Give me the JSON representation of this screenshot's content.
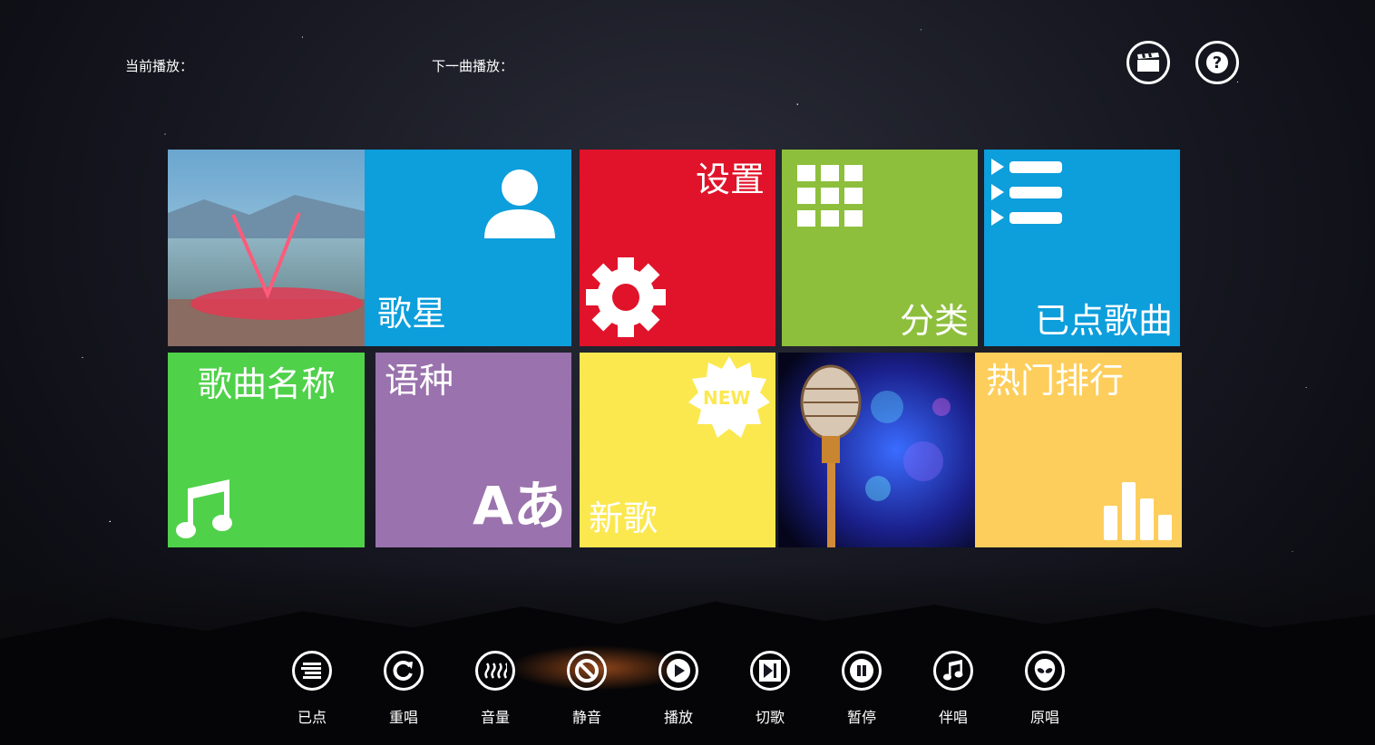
{
  "header": {
    "now_playing_label": "当前播放：",
    "next_song_label": "下一曲播放："
  },
  "tiles": {
    "singer": "歌星",
    "settings": "设置",
    "category": "分类",
    "requested": "已点歌曲",
    "song_name": "歌曲名称",
    "language": "语种",
    "language_glyph": "Aあ",
    "new_badge": "NEW",
    "new_songs": "新歌",
    "hot_rank": "热门排行"
  },
  "controls": [
    {
      "label": "已点",
      "icon": "list-icon"
    },
    {
      "label": "重唱",
      "icon": "replay-icon"
    },
    {
      "label": "音量",
      "icon": "volume-icon"
    },
    {
      "label": "静音",
      "icon": "mute-icon"
    },
    {
      "label": "播放",
      "icon": "play-icon"
    },
    {
      "label": "切歌",
      "icon": "skip-icon"
    },
    {
      "label": "暂停",
      "icon": "pause-icon"
    },
    {
      "label": "伴唱",
      "icon": "music-note-icon"
    },
    {
      "label": "原唱",
      "icon": "alien-icon"
    }
  ],
  "colors": {
    "blue": "#0d9edc",
    "red": "#e0132a",
    "green": "#8dbf3c",
    "lime": "#4fd14a",
    "purple": "#9a72ad",
    "yellow": "#fbe84f",
    "orange": "#fdce5c"
  }
}
